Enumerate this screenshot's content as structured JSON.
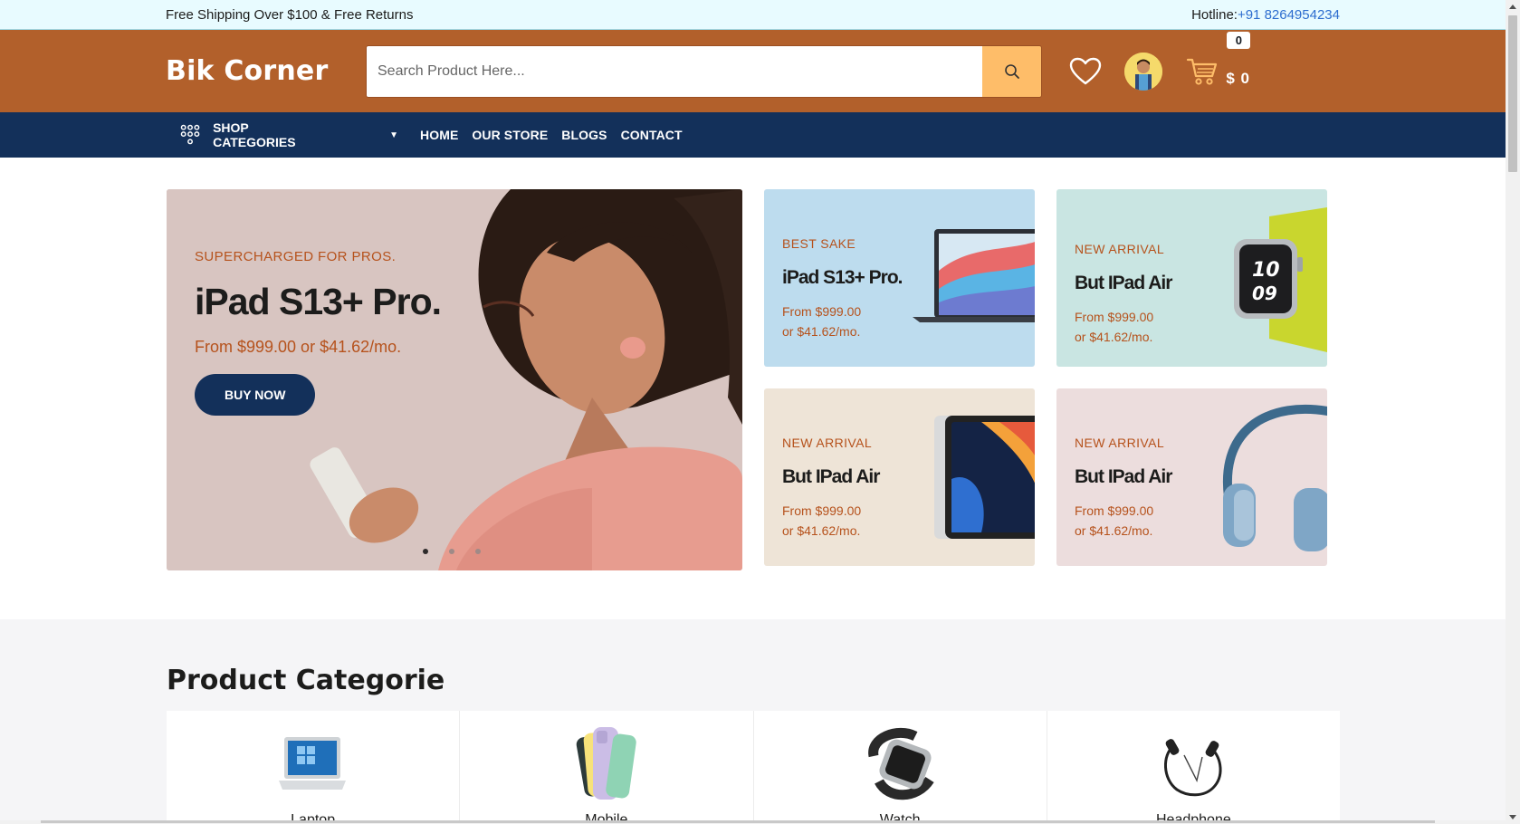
{
  "topbar": {
    "shipping_text": "Free Shipping Over $100 & Free Returns",
    "hotline_label": "Hotline:",
    "hotline_number": "+91 8264954234"
  },
  "header": {
    "brand": "Bik Corner",
    "search_placeholder": "Search Product Here...",
    "cart_count": "0",
    "cart_total": "$ 0"
  },
  "nav": {
    "categories_label": "SHOP CATEGORIES",
    "links": [
      "HOME",
      "OUR STORE",
      "BLOGS",
      "CONTACT"
    ]
  },
  "hero": {
    "main": {
      "eyebrow": "SUPERCHARGED FOR PROS.",
      "title": "iPad S13+ Pro.",
      "price": "From $999.00 or $41.62/mo.",
      "button": "BUY NOW"
    },
    "small": [
      {
        "eyebrow": "BEST SAKE",
        "title": "iPad S13+ Pro.",
        "price_line1": "From $999.00",
        "price_line2": "or $41.62/mo."
      },
      {
        "eyebrow": "NEW ARRIVAL",
        "title": "But IPad Air",
        "price_line1": "From $999.00",
        "price_line2": "or $41.62/mo."
      },
      {
        "eyebrow": "NEW ARRIVAL",
        "title": "But IPad Air",
        "price_line1": "From $999.00",
        "price_line2": "or $41.62/mo."
      },
      {
        "eyebrow": "NEW ARRIVAL",
        "title": "But IPad Air",
        "price_line1": "From $999.00",
        "price_line2": "or $41.62/mo."
      }
    ]
  },
  "categories": {
    "heading": "Product Categorie",
    "items": [
      "Laptop",
      "Mobile",
      "Watch",
      "Headphone"
    ]
  },
  "colors": {
    "header_bg": "#b2602b",
    "nav_bg": "#13305a",
    "search_button": "#febd69",
    "accent_text": "#b6521c"
  }
}
